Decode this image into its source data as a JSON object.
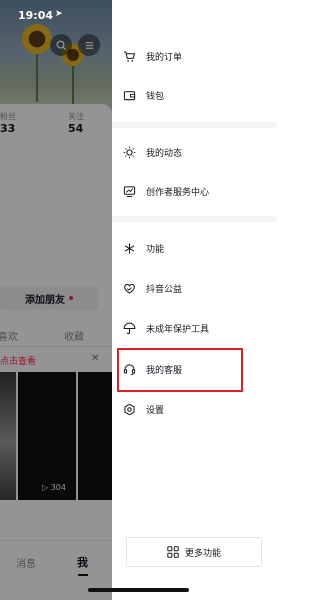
{
  "status_bar": {
    "time": "19:04",
    "location_icon": "location-arrow-icon"
  },
  "background_profile": {
    "stats": [
      {
        "label": "粉丝",
        "value": "33"
      },
      {
        "label": "关注",
        "value": "54"
      }
    ],
    "add_friend_label": "添加朋友",
    "tabs": [
      "喜欢",
      "收藏"
    ],
    "banner_text": "点击查看",
    "video_play_count": "304",
    "bottom_nav": {
      "messages": "消息",
      "me": "我"
    }
  },
  "drawer": {
    "menu": [
      {
        "id": "orders",
        "label": "我的订单",
        "icon": "cart-icon"
      },
      {
        "id": "wallet",
        "label": "钱包",
        "icon": "wallet-icon"
      },
      {
        "id": "activity",
        "label": "我的动态",
        "icon": "sun-icon"
      },
      {
        "id": "creator",
        "label": "创作者服务中心",
        "icon": "creator-chart-icon"
      },
      {
        "id": "features",
        "label": "功能",
        "icon": "asterisk-icon"
      },
      {
        "id": "charity",
        "label": "抖音公益",
        "icon": "heart-hand-icon"
      },
      {
        "id": "minor",
        "label": "未成年保护工具",
        "icon": "umbrella-icon"
      },
      {
        "id": "support",
        "label": "我的客服",
        "icon": "headset-icon"
      },
      {
        "id": "settings",
        "label": "设置",
        "icon": "settings-hexagon-icon"
      }
    ],
    "more_button_label": "更多功能",
    "highlight_color": "#e02020"
  }
}
